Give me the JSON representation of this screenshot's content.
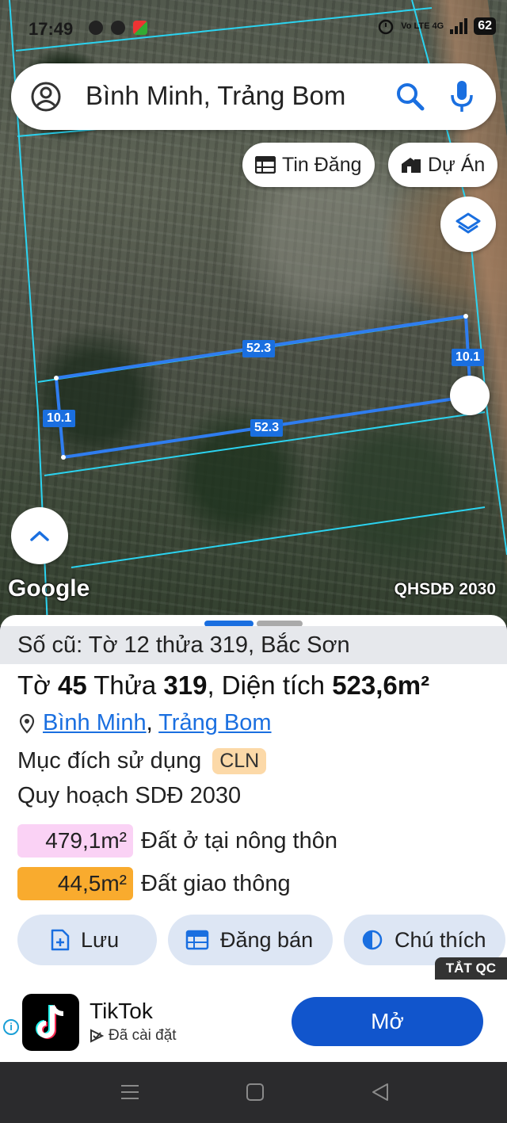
{
  "status_bar": {
    "time": "17:49",
    "network": "Vo LTE 4G",
    "battery": "62"
  },
  "search": {
    "query": "Bình Minh, Trảng Bom"
  },
  "map": {
    "chips": {
      "listings": "Tin Đăng",
      "projects": "Dự Án"
    },
    "dimensions": {
      "top_edge": "52.3",
      "bottom_edge": "52.3",
      "left_edge": "10.1",
      "right_edge": "10.1"
    },
    "google_logo": "Google",
    "plan_label": "QHSDĐ 2030"
  },
  "parcel": {
    "old_number": "Số cũ: Tờ 12 thửa 319, Bắc Sơn",
    "sheet_label": "Tờ ",
    "sheet": "45",
    "plot_label": " Thửa ",
    "plot": "319",
    "area_label": ", Diện tích ",
    "area": "523,6m²",
    "commune": "Bình Minh",
    "district": "Trảng Bom",
    "purpose_label": "Mục đích sử dụng",
    "purpose_code": "CLN",
    "plan_title": "Quy hoạch SDĐ 2030",
    "allocations": [
      {
        "area": "479,1m²",
        "label": "Đất ở tại nông thôn",
        "color": "#fad2f5"
      },
      {
        "area": "44,5m²",
        "label": "Đất giao thông",
        "color": "#f9ab2e"
      }
    ],
    "actions": {
      "save": "Lưu",
      "post": "Đăng bán",
      "legend": "Chú thích"
    },
    "hide_ads": "TẮT QC"
  },
  "ad": {
    "app_name": "TikTok",
    "status": "Đã cài đặt",
    "open_label": "Mở",
    "info": "i"
  },
  "colors": {
    "accent": "#1a6fe0",
    "open_button": "#1155cc",
    "parcel_line": "#2f7df0",
    "plot_border": "#2bd3f0"
  }
}
